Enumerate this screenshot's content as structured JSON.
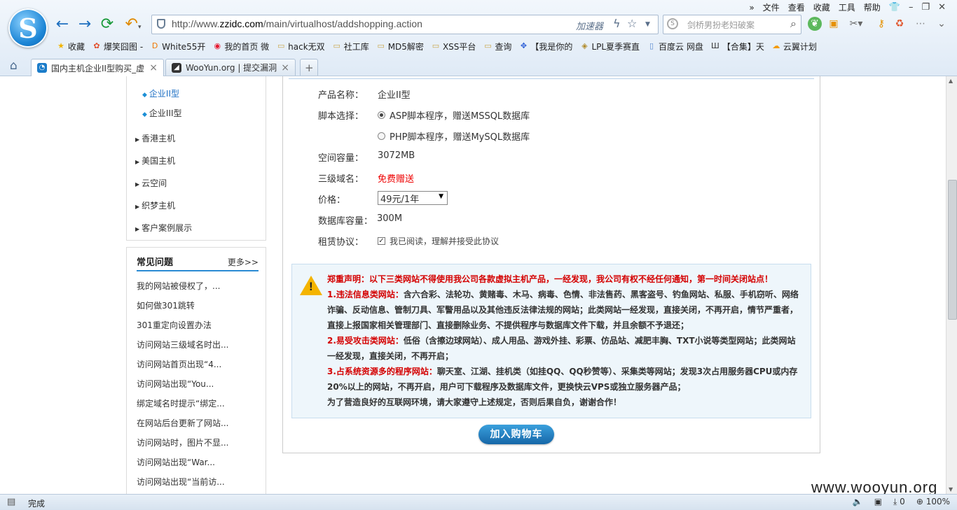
{
  "browser": {
    "menu": [
      "文件",
      "查看",
      "收藏",
      "工具",
      "帮助"
    ],
    "address": {
      "prefix": "http://www.",
      "domain": "zzidc.com",
      "path": "/main/virtualhost/addshopping.action",
      "accelerator": "加速器"
    },
    "search_placeholder": "剑桥男扮老妇破案",
    "favorites": [
      {
        "label": "收藏",
        "icon": "star-icon"
      },
      {
        "label": "爆笑囧图 -",
        "icon": "flower-icon"
      },
      {
        "label": "White55开",
        "icon": "du-icon"
      },
      {
        "label": "我的首页 微",
        "icon": "weibo-icon"
      },
      {
        "label": "hack无双",
        "icon": "folder-icon"
      },
      {
        "label": "社工库",
        "icon": "folder-icon"
      },
      {
        "label": "MD5解密",
        "icon": "folder-icon"
      },
      {
        "label": "XSS平台",
        "icon": "folder-icon"
      },
      {
        "label": "查询",
        "icon": "folder-icon"
      },
      {
        "label": "【我是你的",
        "icon": "paw-icon"
      },
      {
        "label": "LPL夏季赛直",
        "icon": "lol-icon"
      },
      {
        "label": "百度云 网盘",
        "icon": "page-icon"
      },
      {
        "label": "【合集】天",
        "icon": "bars-icon"
      },
      {
        "label": "云翼计划",
        "icon": "cloud-icon"
      }
    ],
    "tabs": [
      {
        "label": "国内主机企业II型购买_虚",
        "active": true
      },
      {
        "label": "WooYun.org | 提交漏洞",
        "active": false
      }
    ],
    "status": "完成",
    "zoom": "100%",
    "downloads": "0"
  },
  "sidebar": {
    "sub_items": [
      "企业II型",
      "企业III型"
    ],
    "categories": [
      "香港主机",
      "美国主机",
      "云空间",
      "织梦主机",
      "客户案例展示"
    ],
    "faq": {
      "title": "常见问题",
      "more": "更多>>",
      "items": [
        "我的网站被侵权了，...",
        "如何做301跳转",
        "301重定向设置办法",
        "访问网站三级域名时出...",
        "访问网站首页出现“4...",
        "访问网站出现“You...",
        "绑定域名时提示“绑定...",
        "在网站后台更新了网站...",
        "访问网站时，图片不显...",
        "访问网站出现“War...",
        "访问网站出现“当前访..."
      ]
    }
  },
  "form": {
    "product_name_label": "产品名称：",
    "product_name": "企业II型",
    "script_label": "脚本选择：",
    "script_options": [
      "ASP脚本程序，赠送MSSQL数据库",
      "PHP脚本程序，赠送MySQL数据库"
    ],
    "space_label": "空间容量：",
    "space": "3072MB",
    "subdomain_label": "三级域名：",
    "subdomain": "免费赠送",
    "price_label": "价格：",
    "price": "49元/1年",
    "db_label": "数据库容量：",
    "db": "300M",
    "agreement_label": "租赁协议：",
    "agreement": "我已阅读，理解并接受此协议"
  },
  "notice": {
    "title": "郑重声明：以下三类网站不得使用我公司各款虚拟主机产品，一经发现，我公司有权不经任何通知，第一时间关闭站点！",
    "c1_head": "1.违法信息类网站：",
    "c1_l1": "含六合彩、法轮功、黄赌毒、木马、病毒、色情、非法售药、黑客盗号、钓鱼网站、私服、手机窃听、网络",
    "c1_l2": "诈骗、反动信息、管制刀具、军警用品以及其他违反法律法规的网站；此类网站一经发现，直接关闭，不再开启，情节严重者，",
    "c1_l3": "直接上报国家相关管理部门、直接删除业务、不提供程序与数据库文件下载，并且余额不予退还；",
    "c2_head": "2.易受攻击类网站：",
    "c2_l1": "低俗（含擦边球网站）、成人用品、游戏外挂、彩票、仿品站、减肥丰胸、TXT小说等类型网站；此类网站",
    "c2_l2": "一经发现，直接关闭，不再开启；",
    "c3_head": "3.占系统资源多的程序网站：",
    "c3_l1": "聊天室、江湖、挂机类（如挂QQ、QQ秒赞等）、采集类等网站；发现3次占用服务器CPU或内存",
    "c3_l2": "20%以上的网站，不再开启，用户可下载程序及数据库文件，更换快云VPS或独立服务器产品；",
    "closing": "为了营造良好的互联网环境，请大家遵守上述规定，否则后果自负，谢谢合作！"
  },
  "add_to_cart": "加入购物车",
  "watermark": "www.wooyun.org",
  "colors": {
    "accent": "#1d6fc4",
    "warning_red": "#d40000",
    "notice_bg": "#eef6fb",
    "button_blue": "#1667a8"
  }
}
